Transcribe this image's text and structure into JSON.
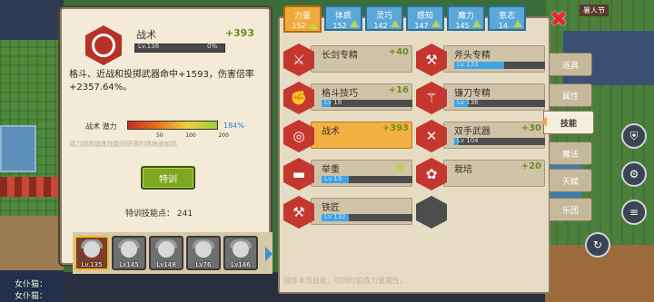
{
  "colors": {
    "panel_bg": "#f3ead7",
    "skill_red": "#c4372f",
    "active_gold": "#f3b043",
    "bonus_green": "#6c8f1c",
    "bar_blue": "#3fa4e8",
    "tab_blue": "#5aa8d8",
    "tab_orange": "#f2a93c",
    "close_red": "#e82a2a",
    "train_green": "#7ea722"
  },
  "detail": {
    "icon": "tactics-hex-icon",
    "name": "战术",
    "bonus": "+393",
    "level_label": "Lv.138",
    "level_pct": "0%",
    "level_progress": 0,
    "description": "格斗、近战和投掷武器命中+1593，伤害倍率+2357.64%。",
    "potential_label": "战术 潜力",
    "potential_ticks": [
      "50",
      "100",
      "200"
    ],
    "potential_value": "184%",
    "note": "潜力越高锻炼技能时获得的熟练度越高",
    "train_button": "特训",
    "train_points": "特训技能点： 241"
  },
  "heroes": [
    {
      "lv": "Lv.135",
      "selected": true
    },
    {
      "lv": "Lv145",
      "selected": false
    },
    {
      "lv": "Lv148",
      "selected": false
    },
    {
      "lv": "Lv76",
      "selected": false
    },
    {
      "lv": "Lv146",
      "selected": false
    }
  ],
  "tabs": [
    {
      "label": "力量",
      "value": "152",
      "active": true
    },
    {
      "label": "体质",
      "value": "152",
      "active": false
    },
    {
      "label": "灵巧",
      "value": "142",
      "active": false
    },
    {
      "label": "感知",
      "value": "147",
      "active": false
    },
    {
      "label": "魔力",
      "value": "145",
      "active": false
    },
    {
      "label": "意志",
      "value": "14",
      "active": false
    }
  ],
  "skills": [
    {
      "name": "长剑专精",
      "bonus": "+40",
      "lv": "",
      "progress": 0.0,
      "icon": "sword-icon",
      "glyph": "⚔"
    },
    {
      "name": "斧头专精",
      "bonus": "",
      "lv": "Lv 133",
      "progress": 0.55,
      "icon": "axe-icon",
      "glyph": "⚒"
    },
    {
      "name": "格斗技巧",
      "bonus": "+16",
      "lv": "Lv 18",
      "progress": 0.1,
      "icon": "fist-icon",
      "glyph": "✊"
    },
    {
      "name": "镰刀专精",
      "bonus": "",
      "lv": "Lv 136",
      "progress": 0.15,
      "icon": "scythe-icon",
      "glyph": "⚚"
    },
    {
      "name": "战术",
      "bonus": "+393",
      "lv": "",
      "progress": 0.0,
      "icon": "tactics-icon",
      "glyph": "◎",
      "active": true
    },
    {
      "name": "双手武器",
      "bonus": "+30",
      "lv": "Lv 104",
      "progress": 0.05,
      "icon": "crossed-swords-icon",
      "glyph": "✕"
    },
    {
      "name": "举重",
      "bonus": "",
      "lv": "Lv 19",
      "progress": 0.3,
      "icon": "barbell-icon",
      "glyph": "▬"
    },
    {
      "name": "栽培",
      "bonus": "+20",
      "lv": "",
      "progress": 0.0,
      "icon": "plant-icon",
      "glyph": "✿"
    },
    {
      "name": "铁匠",
      "bonus": "",
      "lv": "Lv 132",
      "progress": 0.3,
      "icon": "anvil-icon",
      "glyph": "⚒"
    },
    {
      "name": "",
      "bonus": "",
      "lv": "",
      "progress": 0.0,
      "icon": "locked-hex-icon",
      "glyph": "",
      "empty": true
    }
  ],
  "side_tabs": [
    "道具",
    "属性",
    "技能",
    "魔法",
    "天赋",
    "乐团"
  ],
  "active_side_tab": 2,
  "footer_note": "锻炼本页技能，可同时锻炼力量属性。",
  "topright": "暑人节",
  "chat": [
    "女仆猫：",
    "女仆猫："
  ]
}
